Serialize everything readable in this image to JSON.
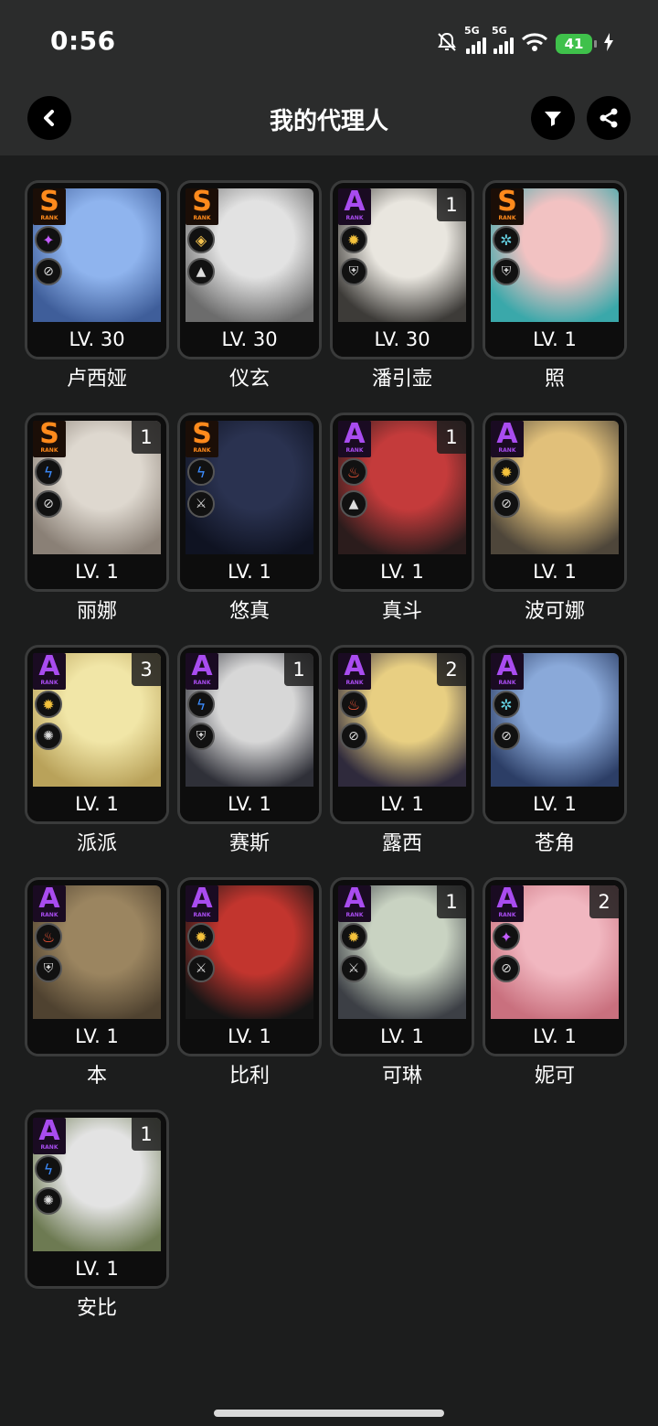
{
  "status": {
    "time": "0:56",
    "battery": "41",
    "net1": "5G",
    "net2": "5G"
  },
  "header": {
    "title": "我的代理人"
  },
  "agents": [
    {
      "name": "卢西娅",
      "rank": "S",
      "level": "LV. 30",
      "cons": "",
      "attr": "ether",
      "role": "support",
      "c1": "#8fb4ee",
      "c2": "#3f5e9a"
    },
    {
      "name": "仪玄",
      "rank": "S",
      "level": "LV. 30",
      "cons": "",
      "attr": "auric",
      "role": "rupture",
      "c1": "#e2e2e2",
      "c2": "#6c6c6c"
    },
    {
      "name": "潘引壶",
      "rank": "A",
      "level": "LV. 30",
      "cons": "1",
      "attr": "physical",
      "role": "defense",
      "c1": "#e9e6df",
      "c2": "#3d3b38"
    },
    {
      "name": "照",
      "rank": "S",
      "level": "LV. 1",
      "cons": "",
      "attr": "ice",
      "role": "defense",
      "c1": "#f2c2c2",
      "c2": "#3aa8aa"
    },
    {
      "name": "丽娜",
      "rank": "S",
      "level": "LV. 1",
      "cons": "1",
      "attr": "electric",
      "role": "support",
      "c1": "#ded8cf",
      "c2": "#8a8076"
    },
    {
      "name": "悠真",
      "rank": "S",
      "level": "LV. 1",
      "cons": "",
      "attr": "electric",
      "role": "attack",
      "c1": "#2a3250",
      "c2": "#0f1322"
    },
    {
      "name": "真斗",
      "rank": "A",
      "level": "LV. 1",
      "cons": "1",
      "attr": "fire",
      "role": "rupture",
      "c1": "#c43b3b",
      "c2": "#2b1c1c"
    },
    {
      "name": "波可娜",
      "rank": "A",
      "level": "LV. 1",
      "cons": "",
      "attr": "physical",
      "role": "support",
      "c1": "#e1c07a",
      "c2": "#4e463a"
    },
    {
      "name": "派派",
      "rank": "A",
      "level": "LV. 1",
      "cons": "3",
      "attr": "physical",
      "role": "anomaly",
      "c1": "#f1e6a7",
      "c2": "#b9a25a"
    },
    {
      "name": "赛斯",
      "rank": "A",
      "level": "LV. 1",
      "cons": "1",
      "attr": "electric",
      "role": "defense",
      "c1": "#d7d7d7",
      "c2": "#2f3038"
    },
    {
      "name": "露西",
      "rank": "A",
      "level": "LV. 1",
      "cons": "2",
      "attr": "fire",
      "role": "support",
      "c1": "#e8cf82",
      "c2": "#2f2a3c"
    },
    {
      "name": "苍角",
      "rank": "A",
      "level": "LV. 1",
      "cons": "",
      "attr": "ice",
      "role": "support",
      "c1": "#8aa9d9",
      "c2": "#2c3e66"
    },
    {
      "name": "本",
      "rank": "A",
      "level": "LV. 1",
      "cons": "",
      "attr": "fire",
      "role": "defense",
      "c1": "#9b8560",
      "c2": "#4f4230"
    },
    {
      "name": "比利",
      "rank": "A",
      "level": "LV. 1",
      "cons": "",
      "attr": "physical",
      "role": "attack",
      "c1": "#c2352e",
      "c2": "#151515"
    },
    {
      "name": "可琳",
      "rank": "A",
      "level": "LV. 1",
      "cons": "1",
      "attr": "physical",
      "role": "attack",
      "c1": "#c9d3c2",
      "c2": "#3c3f45"
    },
    {
      "name": "妮可",
      "rank": "A",
      "level": "LV. 1",
      "cons": "2",
      "attr": "ether",
      "role": "support",
      "c1": "#f1b7c0",
      "c2": "#c9707e"
    },
    {
      "name": "安比",
      "rank": "A",
      "level": "LV. 1",
      "cons": "1",
      "attr": "electric",
      "role": "anomaly",
      "c1": "#e3e3e3",
      "c2": "#6d7a52"
    }
  ]
}
